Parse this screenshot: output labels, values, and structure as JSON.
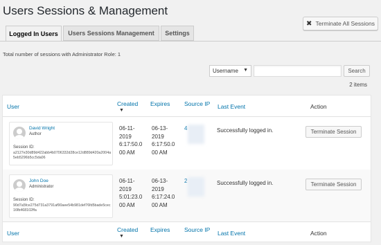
{
  "page": {
    "title": "Users Sessions & Management",
    "terminate_all_label": "Terminate All Sessions"
  },
  "tabs": [
    {
      "label": "Logged In Users",
      "active": true
    },
    {
      "label": "Users Sessions Management",
      "active": false
    },
    {
      "label": "Settings",
      "active": false
    }
  ],
  "summary": "Total number of sessions with Administrator Role: 1",
  "filter": {
    "select_value": "Username",
    "search_placeholder": "",
    "search_label": "Search",
    "items_count": "2 items"
  },
  "table": {
    "columns": {
      "user": "User",
      "created": "Created",
      "expires": "Expires",
      "source_ip": "Source IP",
      "last_event": "Last Event",
      "action": "Action"
    },
    "sort_indicator": "▼",
    "rows": [
      {
        "name": "David Wright",
        "role": "Author",
        "session_label": "Session ID:",
        "session_id": "a2127e30d89d422abb4b0706332d28ce12d889d420a2004a5eb5296b5cc5da06",
        "created": "06-11-\n2019\n6:17:50.0\n00 AM",
        "expires": "06-13-\n2019\n6:17:50.0\n00 AM",
        "ip_prefix": "4",
        "last_event": "Successfully logged in.",
        "action_label": "Terminate Session"
      },
      {
        "name": "John Doe",
        "role": "Administrator",
        "session_label": "Session ID:",
        "session_id": "90d7a5fce275d731a3791af90aee54b981def76fd5bade5cec16fb468102ffa",
        "created": "06-11-\n2019\n5:01:23.0\n00 AM",
        "expires": "06-13-\n2019\n6:17:24.0\n00 AM",
        "ip_prefix": "2",
        "last_event": "Successfully logged in.",
        "action_label": "Terminate Session"
      }
    ]
  },
  "colors": {
    "link": "#0073aa",
    "background": "#f1f1f1"
  },
  "icons": {
    "terminate_all": "close-icon",
    "avatar": "user-avatar-icon"
  }
}
